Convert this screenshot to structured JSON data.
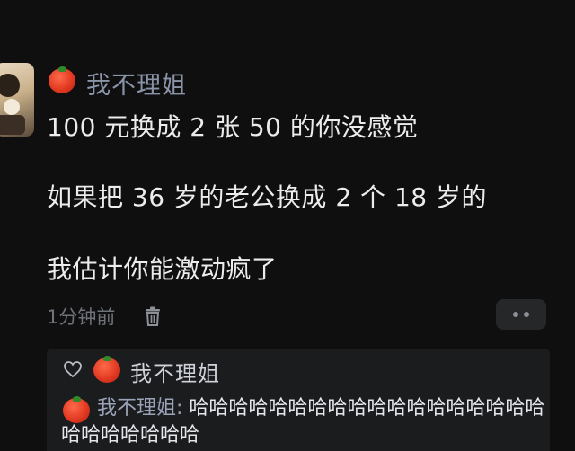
{
  "post": {
    "username": "我不理姐",
    "lines": [
      "100 元换成 2 张 50 的你没感觉",
      "如果把 36 岁的老公换成 2 个 18 岁的",
      "我估计你能激动疯了"
    ],
    "timestamp": "1分钟前",
    "delete_icon": "trash-icon",
    "more_icon": "more-dots-icon"
  },
  "reply": {
    "like_icon": "heart-icon",
    "name": "我不理姐",
    "comment_author": "我不理姐:",
    "comment_text": " 哈哈哈哈哈哈哈哈哈哈哈哈哈哈哈哈哈哈哈哈哈哈哈哈哈"
  },
  "colors": {
    "background": "#0f0f10",
    "username": "#8a93a8",
    "text": "#ececec",
    "reply_bg": "#1b1c1e"
  }
}
